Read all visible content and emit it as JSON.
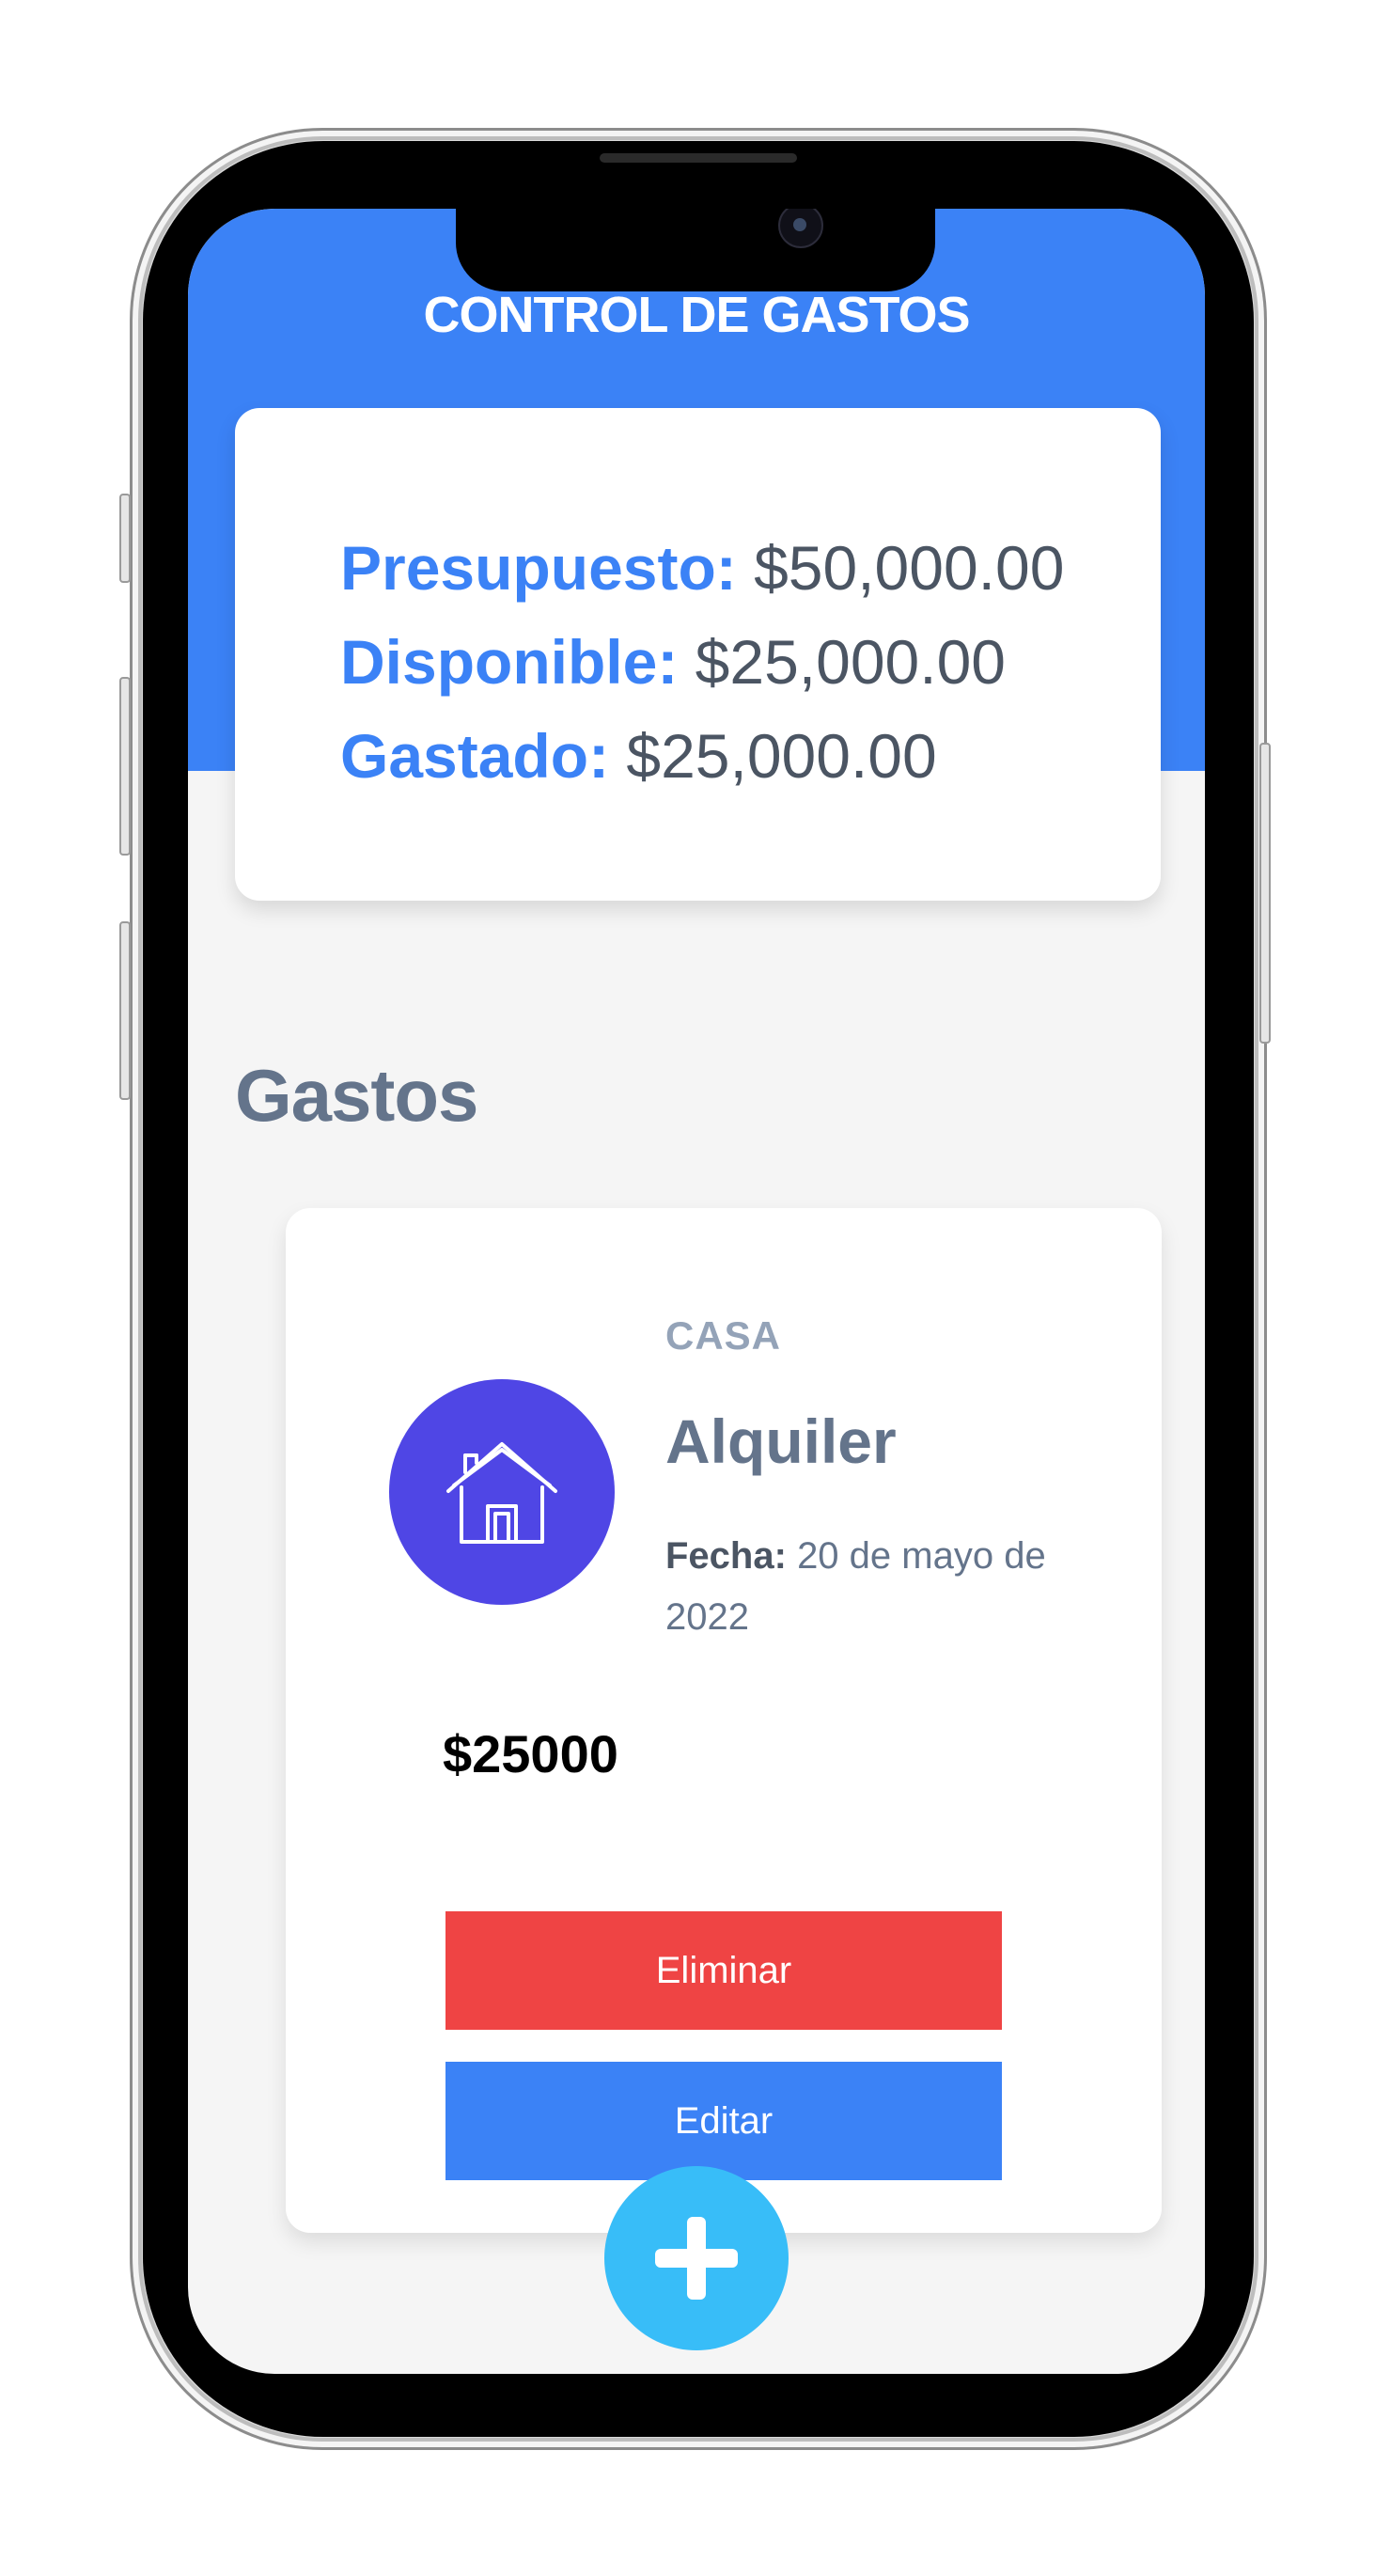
{
  "header": {
    "title": "CONTROL DE GASTOS"
  },
  "budget": {
    "presupuesto_label": "Presupuesto:",
    "presupuesto_value": "$50,000.00",
    "disponible_label": "Disponible:",
    "disponible_value": "$25,000.00",
    "gastado_label": "Gastado:",
    "gastado_value": "$25,000.00"
  },
  "expenses_section": {
    "title": "Gastos",
    "items": [
      {
        "category": "CASA",
        "name": "Alquiler",
        "date_label": "Fecha:",
        "date_value": "20 de mayo de 2022",
        "amount": "$25000",
        "icon": "house-icon",
        "delete_label": "Eliminar",
        "edit_label": "Editar"
      }
    ]
  },
  "fab": {
    "icon": "plus-icon"
  },
  "colors": {
    "primary": "#3b82f6",
    "danger": "#ef4444",
    "category_icon_bg": "#4f46e5",
    "fab": "#38bdf8",
    "background": "#f5f5f5"
  }
}
